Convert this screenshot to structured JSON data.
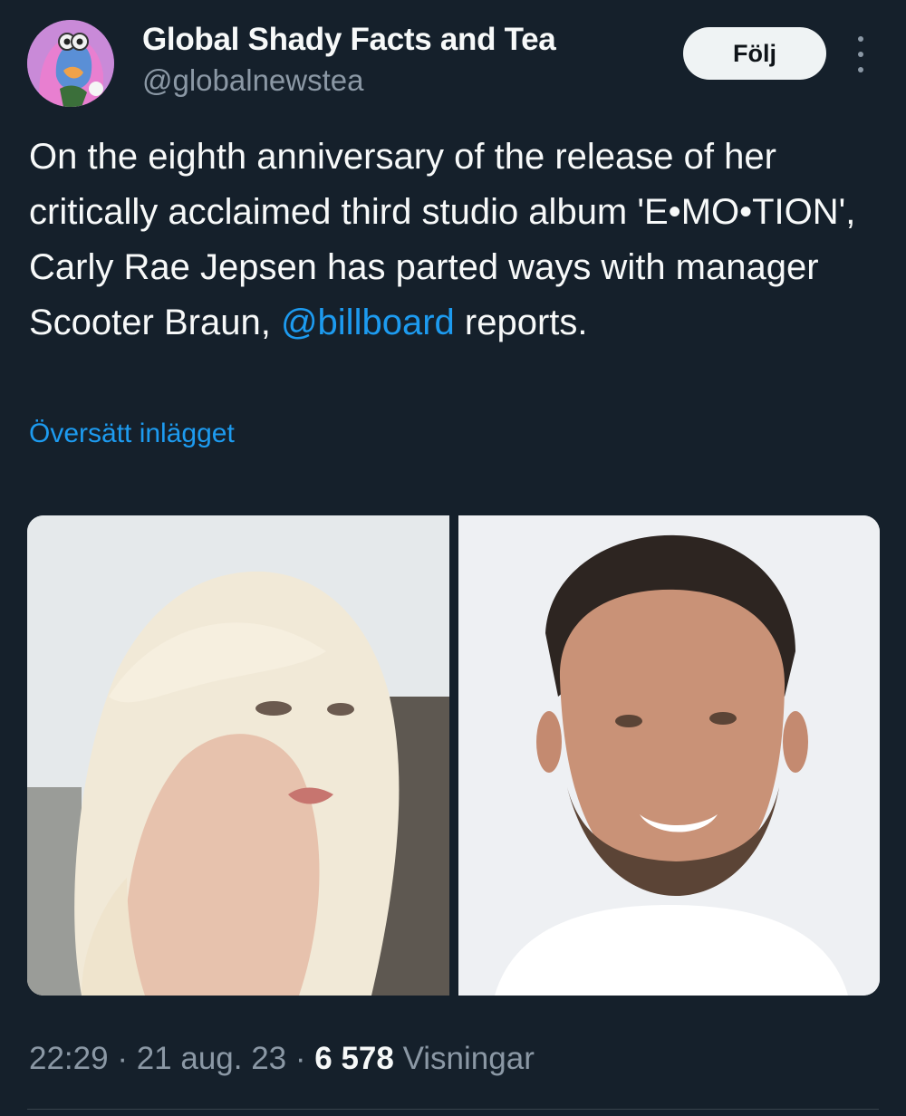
{
  "author": {
    "display_name": "Global Shady Facts and Tea",
    "handle": "@globalnewstea",
    "avatar_icon": "avatar-icon"
  },
  "actions": {
    "follow_label": "Följ",
    "more_icon": "more-vertical-icon"
  },
  "tweet": {
    "text_part1": "On the eighth anniversary of the release of her critically acclaimed third studio album 'E•MO•TION', Carly Rae Jepsen has parted ways with manager Scooter Braun, ",
    "mention": "@billboard",
    "text_part2": " reports.",
    "translate_label": "Översätt inlägget"
  },
  "media": {
    "count": 2
  },
  "meta": {
    "time": "22:29",
    "sep1": " · ",
    "date": "21 aug. 23",
    "sep2": " · ",
    "views_count": "6 578",
    "views_label": " Visningar"
  },
  "colors": {
    "background": "#15202b",
    "link": "#1d9bf0",
    "muted": "#8b98a5",
    "text": "#f7f9f9"
  }
}
